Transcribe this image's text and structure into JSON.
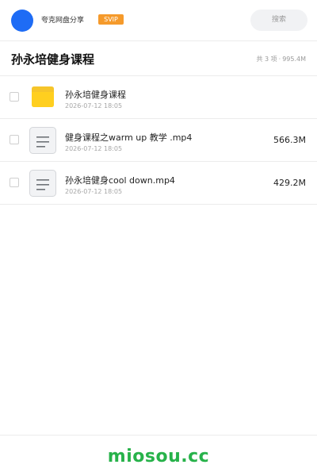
{
  "header": {
    "share_name": "夸克网盘分享",
    "badge": "SVIP",
    "search_placeholder": "搜索",
    "avatar_color": "#1e6cf5",
    "badge_color": "#f59a2b"
  },
  "folder": {
    "title": "孙永培健身课程",
    "count_label": "共 3 项",
    "total_size": "995.4M"
  },
  "files": [
    {
      "type": "folder",
      "icon": "folder-icon",
      "name": "孙永培健身课程",
      "date": "2026-07-12 18:05",
      "size": ""
    },
    {
      "type": "video",
      "icon": "document-icon",
      "name": "健身课程之warm up 教学 .mp4",
      "date": "2026-07-12 18:05",
      "size": "566.3M"
    },
    {
      "type": "video",
      "icon": "document-icon",
      "name": "孙永培健身cool down.mp4",
      "date": "2026-07-12 18:05",
      "size": "429.2M"
    }
  ],
  "footer": {
    "brand": "miosou.cc",
    "brand_color": "#27b24a"
  }
}
